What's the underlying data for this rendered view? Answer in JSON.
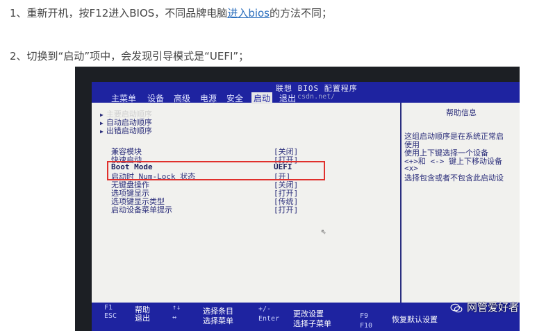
{
  "step1": {
    "before": "1、重新开机，按F12进入BIOS，不同品牌电脑",
    "link": "进入bios",
    "after": "的方法不同；"
  },
  "step2": {
    "text": "2、切换到“启动”项中，会发现引导模式是“UEFI”；"
  },
  "bios": {
    "title": "联想 BIOS 配置程序",
    "menu": [
      "主菜单",
      "设备",
      "高级",
      "电源",
      "安全",
      "启动",
      "退出"
    ],
    "active_menu": "启动",
    "watermark": "csdn.net/",
    "nav": [
      "主要启动顺序",
      "自动启动顺序",
      "出错启动顺序"
    ],
    "options": [
      {
        "label": "兼容模块",
        "value": "[关闭]"
      },
      {
        "label": "快速启动",
        "value": "[打开]"
      },
      {
        "label": "Boot Mode",
        "value": "UEFI"
      },
      {
        "label": "启动时 Num-Lock 状态",
        "value": "[开]"
      },
      {
        "label": "无键盘操作",
        "value": "[关闭]"
      },
      {
        "label": "选项键显示",
        "value": "[打开]"
      },
      {
        "label": "选项键显示类型",
        "value": "[传统]"
      },
      {
        "label": "启动设备菜单提示",
        "value": "[打开]"
      }
    ],
    "help": {
      "title": "帮助信息",
      "lines": [
        "这组启动顺序是在系统正常启",
        "使用",
        "使用上下键选择一个设备",
        "<+>和 <->  键上下移动设备",
        "<x>",
        "选择包含或者不包含此启动设"
      ]
    },
    "footer": {
      "keys": [
        {
          "key": "F1",
          "desc": "帮助"
        },
        {
          "key": "ESC",
          "desc": "退出"
        },
        {
          "key": "↑↓",
          "desc": "选择条目"
        },
        {
          "key": "↔",
          "desc": "选择菜单"
        },
        {
          "key": "+/-",
          "desc": "更改设置"
        },
        {
          "key": "Enter",
          "desc": "选择子菜单"
        },
        {
          "key": "F9",
          "desc": "恢复默认设置"
        },
        {
          "key": "F10",
          "desc": ""
        }
      ]
    }
  },
  "badge": {
    "text": "网管爱好者"
  }
}
